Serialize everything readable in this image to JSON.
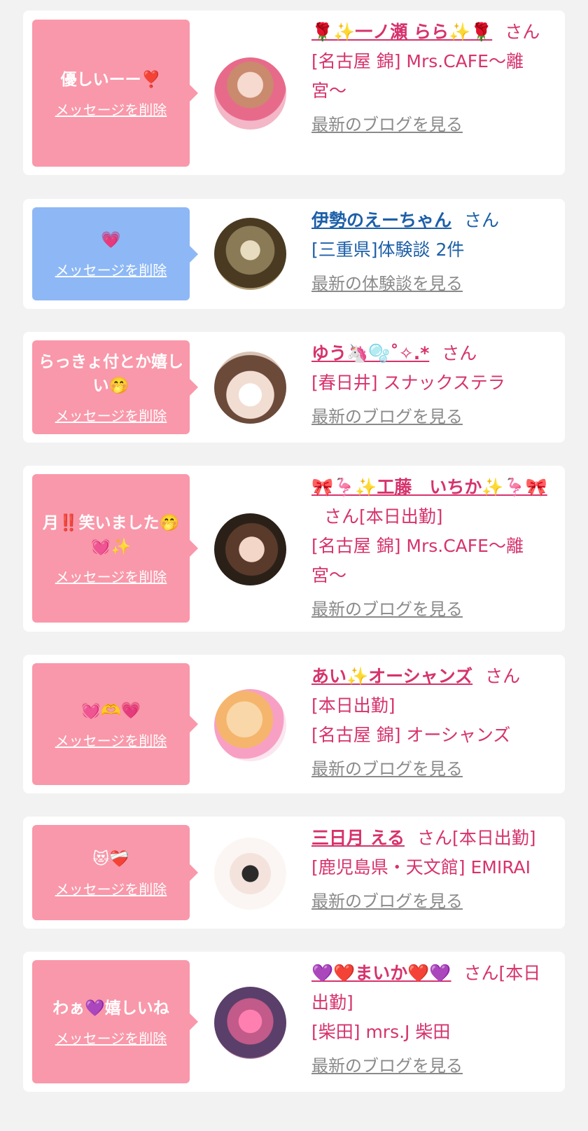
{
  "delete_label": "メッセージを削除",
  "san_label": "さん",
  "cards": [
    {
      "message": "優しいーー❣️",
      "name": "🌹✨一ノ瀬 らら✨🌹",
      "status": "",
      "shop": "[名古屋 錦] Mrs.CAFE〜離宮〜",
      "link": "最新のブログを見る"
    },
    {
      "message": "💗",
      "name": "伊勢のえーちゃん",
      "status": "",
      "shop": "[三重県]体験談 2件",
      "link": "最新の体験談を見る"
    },
    {
      "message": "らっきょ付とか嬉しい🤭",
      "name": "ゆう🦄🫧˚✧.*",
      "status": "",
      "shop": "[春日井] スナックステラ",
      "link": "最新のブログを見る"
    },
    {
      "message": "月‼️笑いました🤭💓✨",
      "name": "🎀🦩✨工藤　いちか✨🦩🎀",
      "status": "[本日出勤]",
      "shop": "[名古屋 錦] Mrs.CAFE〜離宮〜",
      "link": "最新のブログを見る"
    },
    {
      "message": "💓🫶💗",
      "name": "あい✨オーシャンズ",
      "status": "[本日出勤]",
      "shop": "[名古屋 錦] オーシャンズ",
      "link": "最新のブログを見る"
    },
    {
      "message": "😻❤️‍🩹",
      "name": "三日月 える",
      "status": "[本日出勤]",
      "shop": "[鹿児島県・天文館] EMIRAI",
      "link": "最新のブログを見る"
    },
    {
      "message": "わぁ💜嬉しいね",
      "name": "💜❤️まいか❤️💜",
      "status": "[本日出勤]",
      "shop": "[柴田] mrs.J 柴田",
      "link": "最新のブログを見る"
    }
  ],
  "colors": {
    "pink_bubble": "#f998aa",
    "blue_bubble": "#8db8f5",
    "pink_text": "#d6336c",
    "blue_text": "#1d5fa8",
    "link_gray": "#8a8a8a"
  }
}
